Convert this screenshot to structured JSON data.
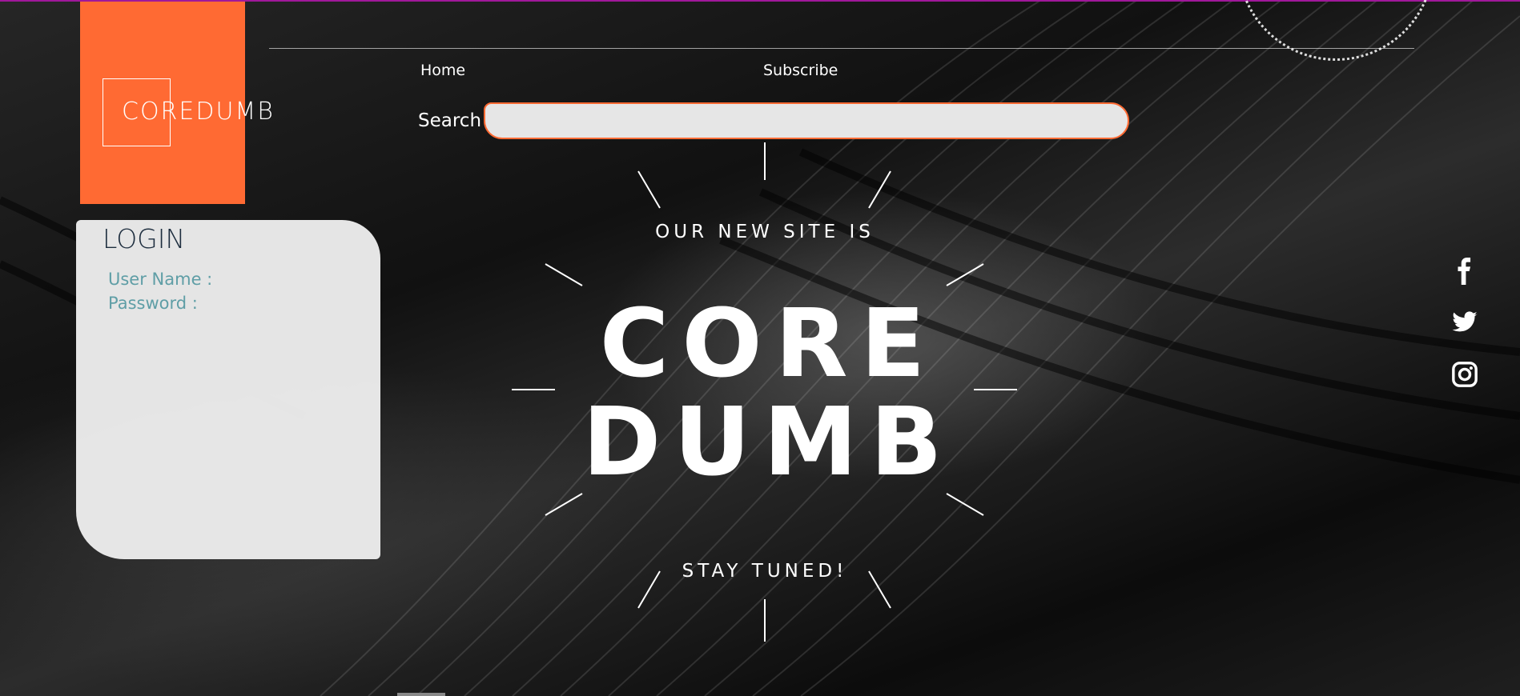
{
  "brand": {
    "logo_text": "COREDUMB",
    "accent": "#ff6a33",
    "top_line_color": "#a0189a"
  },
  "nav": {
    "items": [
      {
        "label": "Home"
      },
      {
        "label": "Subscribe"
      }
    ]
  },
  "search": {
    "label": "Search",
    "value": "",
    "placeholder": ""
  },
  "login": {
    "title": "LOGIN",
    "fields": [
      {
        "label": "User Name :"
      },
      {
        "label": "Password :"
      }
    ]
  },
  "hero": {
    "kicker": "OUR NEW SITE IS",
    "title_line1": "CORE",
    "title_line2": "DUMB",
    "tagline": "STAY TUNED!"
  },
  "social": [
    {
      "icon": "facebook-icon"
    },
    {
      "icon": "twitter-icon"
    },
    {
      "icon": "instagram-icon"
    }
  ]
}
